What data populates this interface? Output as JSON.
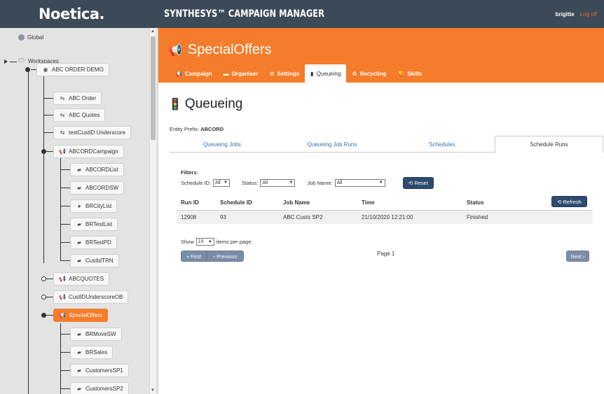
{
  "brand": {
    "logo": "Noetica."
  },
  "topbar": {
    "app_title": "SYNTHESYS™ CAMPAIGN MANAGER",
    "username": "brigitte",
    "logoff": "Log off"
  },
  "tree": {
    "global": "Global",
    "workspaces": "Workspaces",
    "abc_order_demo": "ABC ORDER DEMO",
    "abc_order": "ABC Order",
    "abc_quotes": "ABC Quotes",
    "testcustid": "testCustID Underscore",
    "abcord_campaign": "ABCORDCampaign",
    "abcord_children": [
      "ABCORDList",
      "ABCORDSW",
      "BRCityList",
      "BRTestList",
      "BRTestPD",
      "CustIdTRN"
    ],
    "abcquotes": "ABCQUOTES",
    "custid_underscore": "CustIDUnderscoreOB",
    "special_offers": "SpecialOffers",
    "special_children": [
      "BRMoveSW",
      "BRSales",
      "CustomersSP1",
      "CustomersSP2"
    ]
  },
  "header": {
    "title": "SpecialOffers",
    "tabs": [
      {
        "label": "Campaign",
        "icon": "megaphone-icon"
      },
      {
        "label": "Organiser",
        "icon": "organiser-icon"
      },
      {
        "label": "Settings",
        "icon": "gear-icon"
      },
      {
        "label": "Queueing",
        "icon": "traffic-light-icon"
      },
      {
        "label": "Recycling",
        "icon": "recycle-icon"
      },
      {
        "label": "Skills",
        "icon": "trophy-icon"
      }
    ]
  },
  "main": {
    "page_title": "Queueing",
    "entity_prefix_label": "Entity Prefix:",
    "entity_prefix_value": "ABCORD",
    "subtabs": [
      "Queueing Jobs",
      "Queueing Job Runs",
      "Schedules",
      "Schedule Runs"
    ],
    "filters": {
      "label": "Filters:",
      "schedule_id_label": "Schedule ID:",
      "schedule_id_value": "All",
      "status_label": "Status:",
      "status_value": "All",
      "job_name_label": "Job Name:",
      "job_name_value": "All",
      "reset": "Reset"
    },
    "refresh": "Refresh",
    "table": {
      "headers": [
        "Run ID",
        "Schedule ID",
        "Job Name",
        "Time",
        "Status"
      ],
      "rows": [
        [
          "12908",
          "93",
          "ABC Custs SP2",
          "21/10/2020 12:21:00",
          "Finished"
        ]
      ]
    },
    "paging": {
      "show": "Show",
      "per_page_value": "15",
      "per_page_suffix": "items per page.",
      "first": "First",
      "previous": "Previous",
      "page_label": "Page 1",
      "next": "Next"
    }
  },
  "colors": {
    "accent": "#f47c2a",
    "topbar": "#3c4a58",
    "button": "#2f4b6f",
    "link": "#3a6ea5"
  }
}
